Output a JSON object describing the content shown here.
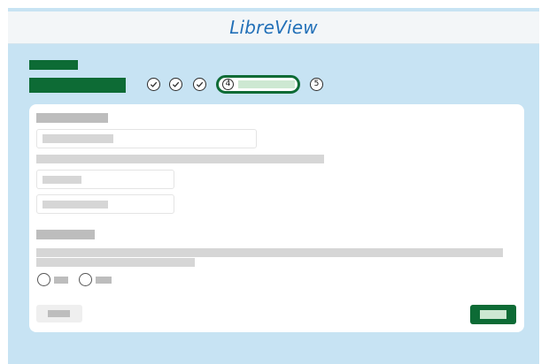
{
  "header": {
    "brand": "LibreView",
    "brand_color": "#2270b8"
  },
  "stepper": {
    "completed_steps": 3,
    "current_step": "4",
    "next_step": "5",
    "accent_color": "#0d6b35",
    "check_icon": "check-circle-icon"
  },
  "colors": {
    "background": "#c7e3f3",
    "card": "#ffffff",
    "primary_button": "#0d6b35",
    "placeholder": "#bdbdbd"
  },
  "form": {
    "radio_options": 2
  }
}
